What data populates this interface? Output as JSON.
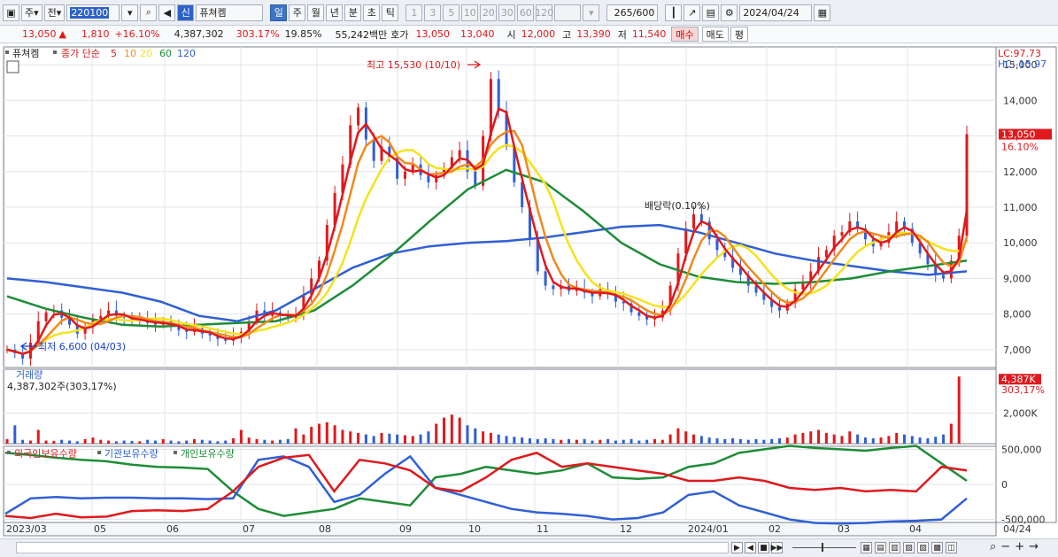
{
  "toolbar": {
    "period_tab": "주",
    "prev_label": "전",
    "code": "220100",
    "search_icon": "search-icon",
    "speaker_icon": "speaker-icon",
    "new_badge": "신",
    "stock_name": "퓨쳐켐",
    "periods": [
      "일",
      "주",
      "월",
      "년",
      "분",
      "초",
      "틱"
    ],
    "selected_period": "일",
    "intervals": [
      "1",
      "3",
      "5",
      "10",
      "20",
      "30",
      "60",
      "120"
    ],
    "count_value": "265",
    "count_total": "/600",
    "date": "2024/04/24"
  },
  "quote": {
    "price": "13,050",
    "change": "1,810",
    "change_rate": "+16.10%",
    "volume": "4,387,302",
    "volume_ratio": "303.17%",
    "turnover": "19.85%",
    "amount": "55,242백만",
    "ask_label": "호가",
    "ask": "13,050",
    "bid": "13,040",
    "open_label": "시",
    "open": "12,000",
    "high_label": "고",
    "high": "13,390",
    "low_label": "저",
    "low": "11,540",
    "buy_label": "매수",
    "sell_label": "매도",
    "eval_label": "평"
  },
  "chart_data": {
    "type": "candlestick",
    "stock_label": "퓨쳐켐",
    "legend_prefix": "종가 단순",
    "ma_periods": [
      "5",
      "10",
      "20",
      "60",
      "120"
    ],
    "ma_colors": [
      "#e0191c",
      "#f08a1c",
      "#f6e21b",
      "#1e8c37",
      "#2f5fd6"
    ],
    "lc_label": "LC:97.73",
    "hc_label": "HC:-15.97",
    "price_axis": [
      "15,000",
      "14,000",
      "13,000",
      "12,000",
      "11,000",
      "10,000",
      "9,000",
      "8,000",
      "7,000"
    ],
    "price_range": [
      6500,
      15500
    ],
    "current_price_tag": "13,050",
    "current_rate_tag": "16.10%",
    "high_annotation": "최고 15,530 (10/10)",
    "low_annotation": "최저 6,600 (04/03)",
    "dividend_annotation": "배당락(0.10%)",
    "close_series": [
      7000,
      6900,
      6750,
      7200,
      7800,
      8050,
      8100,
      7900,
      7700,
      7450,
      7650,
      7850,
      7950,
      8100,
      7950,
      7900,
      7800,
      7850,
      7750,
      7700,
      7800,
      7650,
      7550,
      7500,
      7600,
      7450,
      7400,
      7300,
      7250,
      7350,
      7500,
      7800,
      8100,
      7950,
      8050,
      7950,
      7900,
      8000,
      8550,
      9000,
      9500,
      10500,
      11400,
      12200,
      13300,
      13800,
      12900,
      12300,
      12700,
      12400,
      11800,
      12000,
      12200,
      11900,
      11700,
      11900,
      12100,
      12400,
      12600,
      12000,
      11600,
      13000,
      14600,
      13700,
      12700,
      11700,
      11000,
      10100,
      9200,
      8800,
      8700,
      8800,
      8650,
      8700,
      8600,
      8500,
      8700,
      8550,
      8350,
      8300,
      8050,
      7950,
      7850,
      7900,
      8100,
      8800,
      9700,
      10400,
      10800,
      10600,
      10100,
      9800,
      9600,
      9300,
      9100,
      8800,
      8600,
      8400,
      8200,
      8100,
      8300,
      8700,
      8900,
      9200,
      9600,
      9800,
      10200,
      10300,
      10600,
      10400,
      10100,
      9900,
      10000,
      10300,
      10600,
      10400,
      10000,
      9700,
      9400,
      9100,
      9000,
      9500,
      10200,
      13050
    ],
    "sma60": [
      8500,
      8150,
      7900,
      7700,
      7650,
      7700,
      7750,
      7800,
      8100,
      8800,
      9650,
      10600,
      11500,
      12050,
      11700,
      10900,
      10000,
      9400,
      9050,
      8900,
      8850,
      8900,
      9000,
      9200,
      9350,
      9500
    ],
    "sma120": [
      9000,
      8900,
      8750,
      8600,
      8350,
      7950,
      7800,
      8100,
      8700,
      9300,
      9700,
      9900,
      10000,
      10050,
      10150,
      10300,
      10450,
      10500,
      10300,
      10000,
      9700,
      9500,
      9350,
      9200,
      9100,
      9200
    ],
    "volume_label": "거래량",
    "volume_value": "4,387,302주(303,17%)",
    "volume_tag": "4,387K",
    "volume_rate_tag": "303,17%",
    "volume_axis": [
      "2,000K"
    ],
    "volume_max_k": 4400,
    "volume_series": [
      300,
      1200,
      250,
      200,
      900,
      200,
      180,
      250,
      200,
      150,
      300,
      400,
      250,
      200,
      150,
      200,
      180,
      150,
      250,
      200,
      300,
      200,
      150,
      200,
      300,
      250,
      200,
      150,
      200,
      350,
      900,
      400,
      300,
      250,
      200,
      250,
      300,
      1000,
      600,
      1100,
      1300,
      1400,
      1200,
      900,
      800,
      700,
      600,
      500,
      700,
      650,
      600,
      550,
      500,
      600,
      800,
      1300,
      1700,
      1900,
      1700,
      1200,
      1000,
      800,
      700,
      600,
      500,
      450,
      400,
      350,
      300,
      350,
      300,
      250,
      300,
      250,
      300,
      200,
      250,
      300,
      200,
      250,
      300,
      200,
      250,
      300,
      250,
      600,
      1000,
      800,
      600,
      500,
      400,
      350,
      300,
      350,
      300,
      250,
      300,
      250,
      300,
      350,
      400,
      600,
      700,
      800,
      900,
      700,
      600,
      500,
      800,
      600,
      400,
      350,
      400,
      500,
      700,
      600,
      500,
      400,
      350,
      450,
      600,
      1300,
      4387
    ],
    "supply_legend": [
      "외국인보유수량",
      "기관보유수량",
      "개인보유수량"
    ],
    "supply_colors": [
      "#e0191c",
      "#2f5fd6",
      "#1e8c37"
    ],
    "supply_axis": [
      "500,000",
      "0",
      "-500,000"
    ],
    "foreign_series": [
      -450000,
      -480000,
      -420000,
      -470000,
      -460000,
      -380000,
      -370000,
      -380000,
      -350000,
      -100000,
      250000,
      380000,
      420000,
      -100000,
      350000,
      300000,
      200000,
      -50000,
      -100000,
      100000,
      350000,
      450000,
      250000,
      300000,
      250000,
      200000,
      150000,
      50000,
      50000,
      100000,
      50000,
      -50000,
      -80000,
      -50000,
      -100000,
      -80000,
      -100000,
      250000,
      200000
    ],
    "institution_series": [
      -420000,
      -200000,
      -180000,
      -200000,
      -190000,
      -190000,
      -200000,
      -200000,
      -210000,
      -200000,
      350000,
      400000,
      250000,
      -250000,
      -150000,
      150000,
      400000,
      -50000,
      -150000,
      -250000,
      -350000,
      -400000,
      -420000,
      -450000,
      -500000,
      -480000,
      -400000,
      -150000,
      -100000,
      -300000,
      -400000,
      -500000,
      -550000,
      -560000,
      -550000,
      -530000,
      -520000,
      -500000,
      -200000
    ],
    "individual_series": [
      450000,
      420000,
      380000,
      350000,
      330000,
      280000,
      250000,
      240000,
      220000,
      -100000,
      -350000,
      -450000,
      -400000,
      -350000,
      -200000,
      -250000,
      -300000,
      100000,
      150000,
      250000,
      200000,
      150000,
      200000,
      300000,
      100000,
      80000,
      100000,
      250000,
      300000,
      450000,
      500000,
      550000,
      520000,
      500000,
      480000,
      520000,
      550000,
      300000,
      50000
    ],
    "x_labels": [
      "2023/03",
      "05",
      "06",
      "07",
      "08",
      "09",
      "10",
      "11",
      "12",
      "2024/01",
      "02",
      "03",
      "04"
    ],
    "x_end_label": "04/24"
  },
  "bottom": {
    "nav_prev": "◀",
    "nav_next": "▶",
    "nav_first": "⏮",
    "nav_last": "⏭",
    "zoom_minus": "−",
    "zoom_plus": "+",
    "grid_label": "Q"
  }
}
